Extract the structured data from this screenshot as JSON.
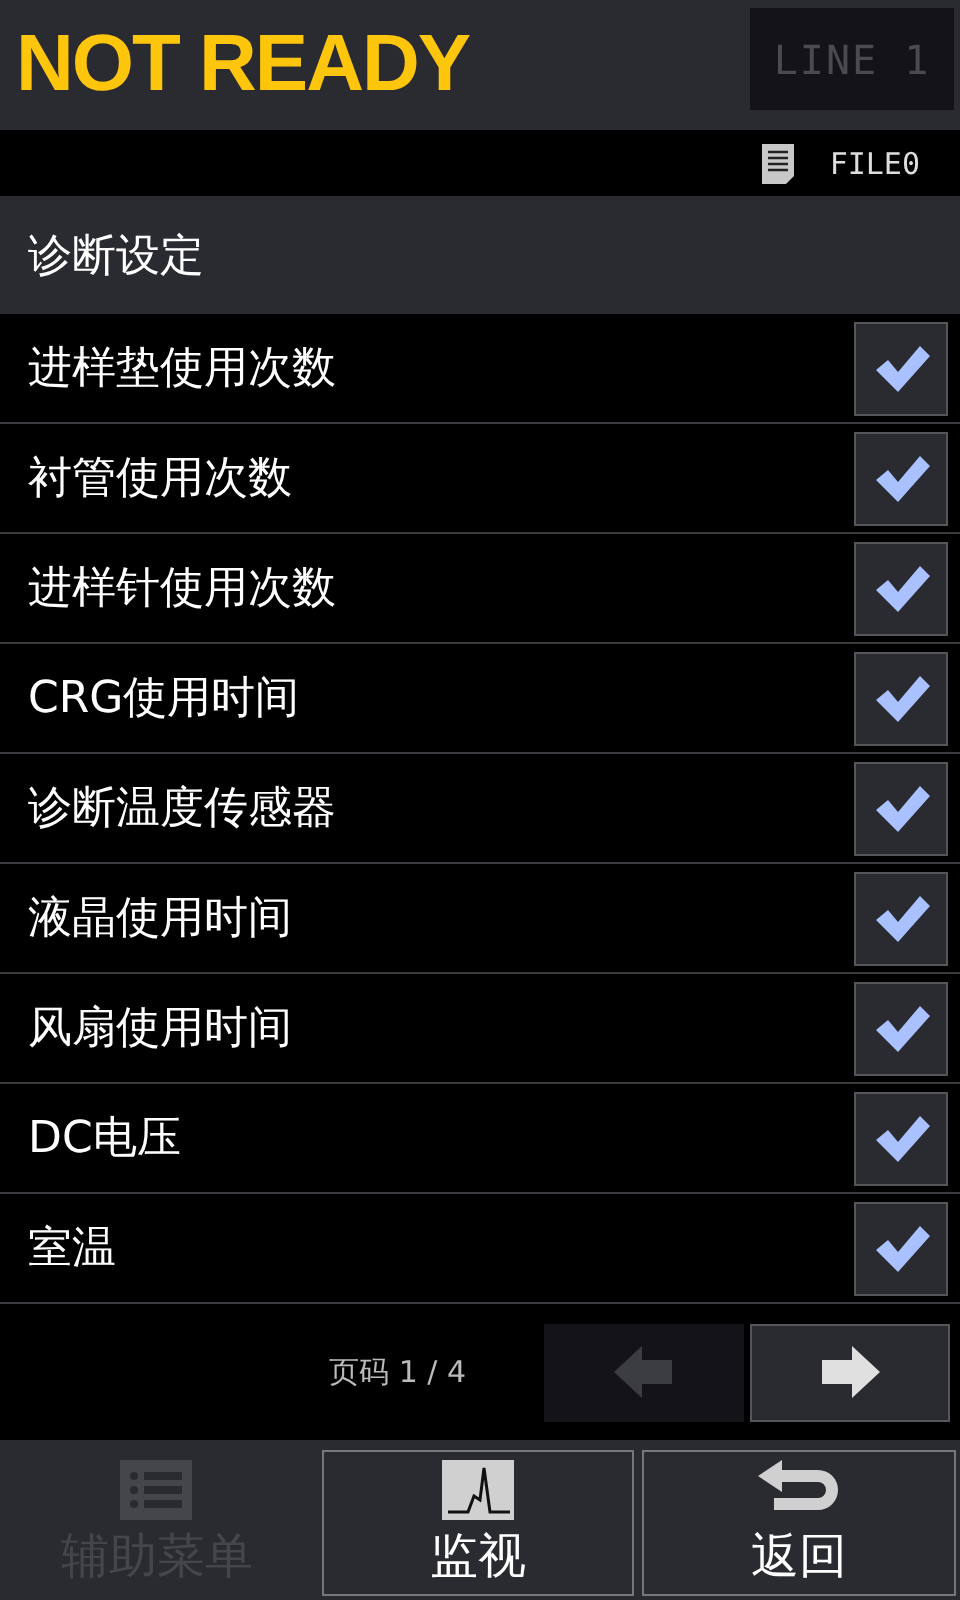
{
  "status": {
    "text": "NOT READY"
  },
  "line": {
    "label": "LINE 1"
  },
  "file": {
    "name": "FILE0"
  },
  "section": {
    "title": "诊断设定"
  },
  "items": [
    {
      "label": "进样垫使用次数",
      "checked": true
    },
    {
      "label": "衬管使用次数",
      "checked": true
    },
    {
      "label": "进样针使用次数",
      "checked": true
    },
    {
      "label": "CRG使用时间",
      "checked": true
    },
    {
      "label": "诊断温度传感器",
      "checked": true
    },
    {
      "label": "液晶使用时间",
      "checked": true
    },
    {
      "label": "风扇使用时间",
      "checked": true
    },
    {
      "label": "DC电压",
      "checked": true
    },
    {
      "label": "室温",
      "checked": true
    }
  ],
  "pager": {
    "text": "页码 1 / 4",
    "prev_disabled": true,
    "next_disabled": false
  },
  "footer": [
    {
      "kind": "menu",
      "label": "辅助菜单",
      "disabled": true
    },
    {
      "kind": "monitor",
      "label": "监视",
      "disabled": false
    },
    {
      "kind": "back",
      "label": "返回",
      "disabled": false
    }
  ]
}
